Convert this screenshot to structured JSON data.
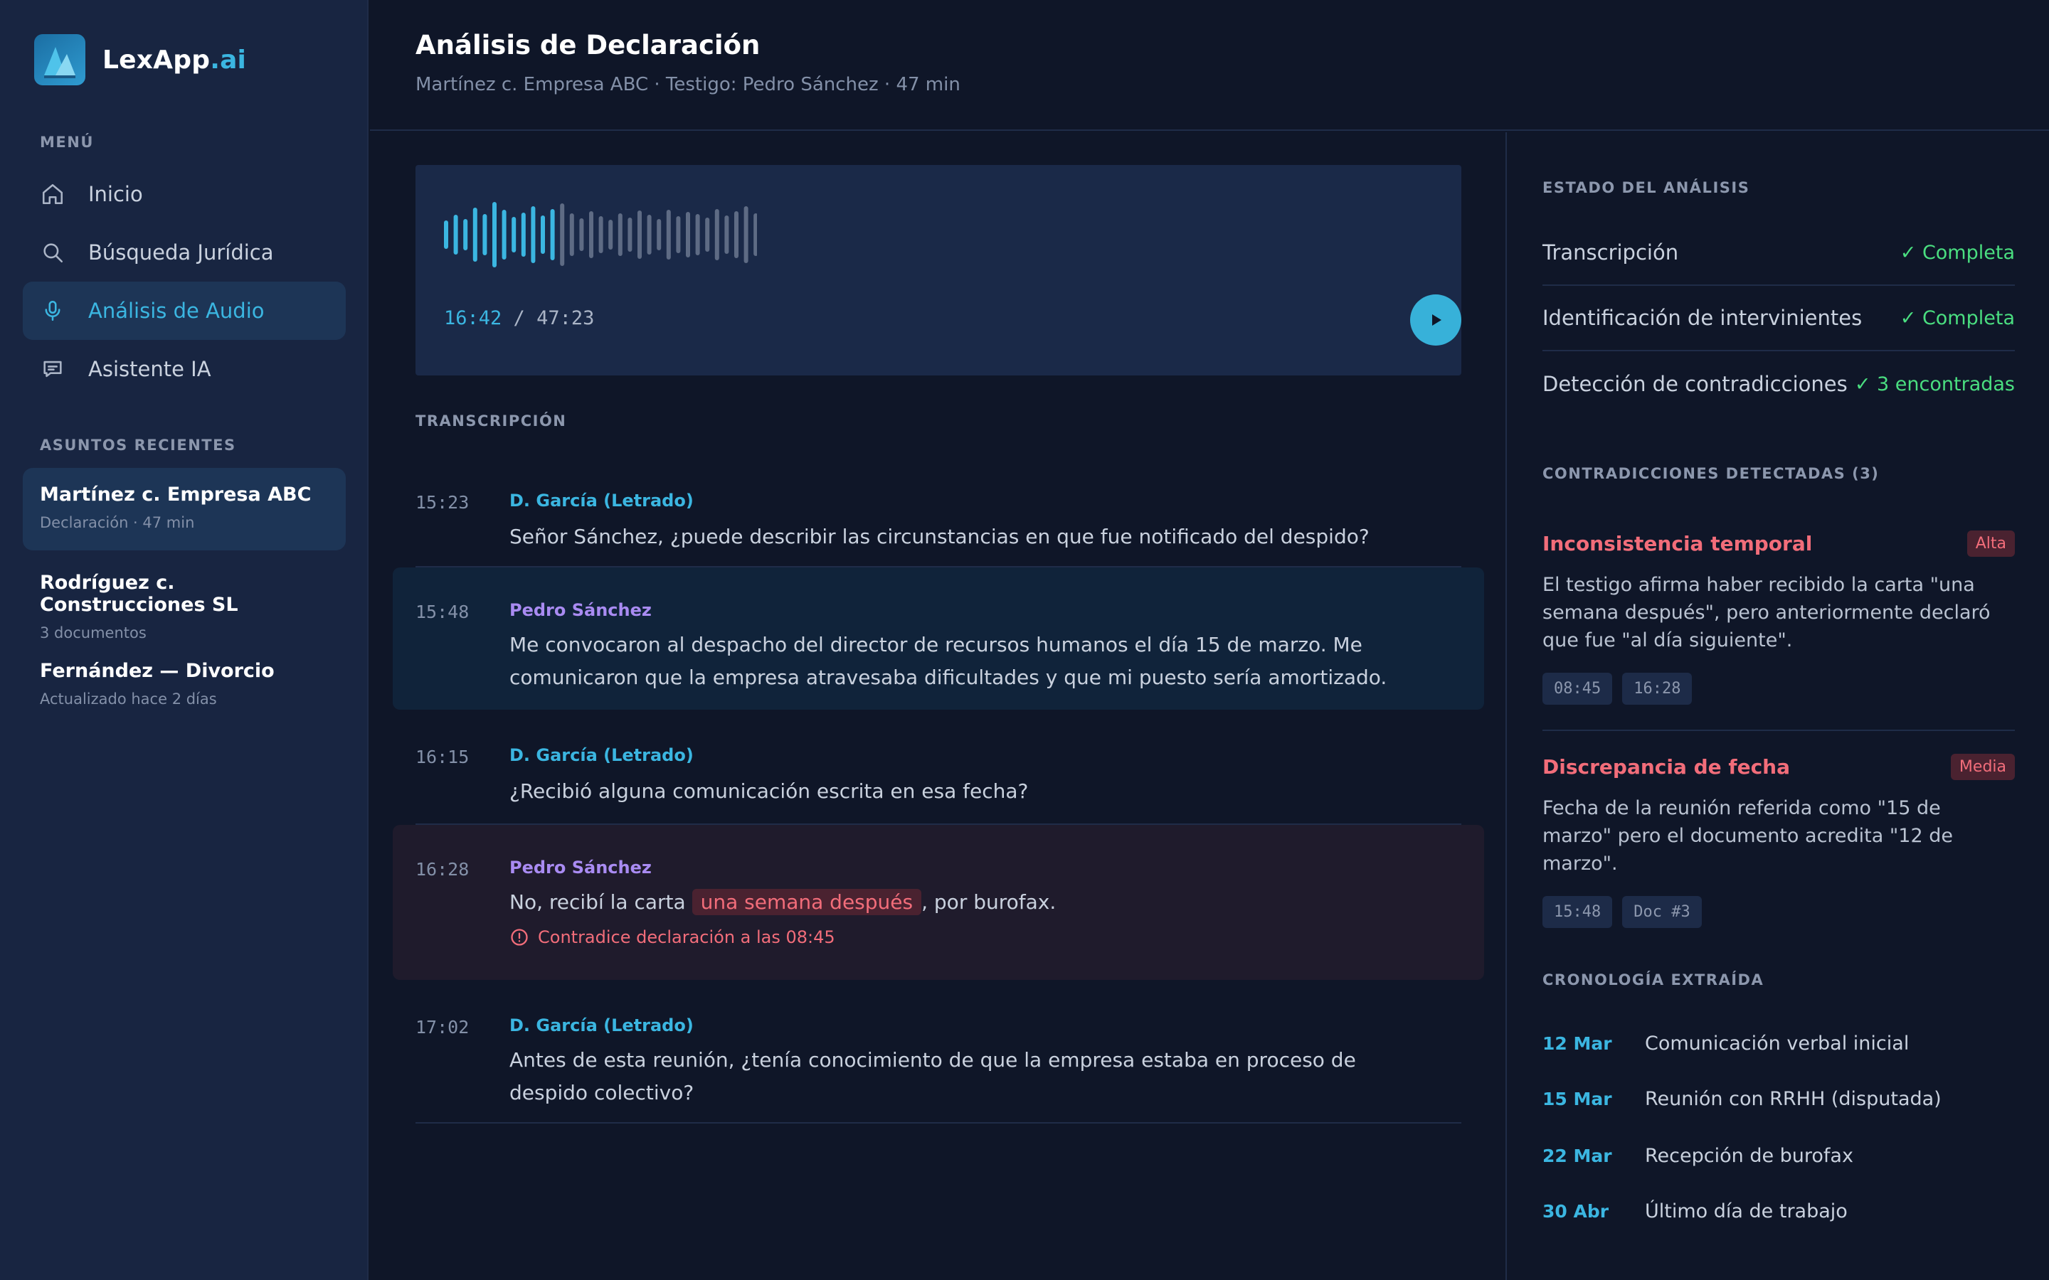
{
  "brand": {
    "name_main": "LexApp",
    "name_tld": ".ai"
  },
  "sidebar": {
    "menu_label": "MENÚ",
    "items": [
      {
        "label": "Inicio",
        "icon": "home-icon"
      },
      {
        "label": "Búsqueda Jurídica",
        "icon": "search-icon"
      },
      {
        "label": "Análisis de Audio",
        "icon": "microphone-icon",
        "active": true
      },
      {
        "label": "Asistente IA",
        "icon": "chat-icon"
      }
    ],
    "recent_label": "ASUNTOS RECIENTES",
    "cases": [
      {
        "title": "Martínez c. Empresa ABC",
        "sub": "Declaración · 47 min",
        "active": true
      },
      {
        "title": "Rodríguez c. Construcciones SL",
        "sub": "3 documentos"
      },
      {
        "title": "Fernández — Divorcio",
        "sub": "Actualizado hace 2 días"
      }
    ]
  },
  "header": {
    "title": "Análisis de Declaración",
    "subtitle": "Martínez c. Empresa ABC · Testigo: Pedro Sánchez · 47 min"
  },
  "player": {
    "current": "16:42",
    "separator": " / ",
    "total": "47:23",
    "progress": 0.353,
    "accent": "#3bb6e1"
  },
  "transcript": {
    "label": "TRANSCRIPCIÓN",
    "entries": [
      {
        "time": "15:23",
        "speaker": "D. García (Letrado)",
        "text": "Señor Sánchez, ¿puede describir las circunstancias en que fue notificado del despido?"
      },
      {
        "time": "15:48",
        "speaker": "Pedro Sánchez",
        "text": "Me convocaron al despacho del director de recursos humanos el día 15 de marzo. Me comunicaron que la empresa atravesaba dificultades y que mi puesto sería amortizado."
      },
      {
        "time": "16:15",
        "speaker": "D. García (Letrado)",
        "text": "¿Recibió alguna comunicación escrita en esa fecha?"
      },
      {
        "time": "16:28",
        "speaker": "Pedro Sánchez",
        "text_before": "No, recibí la carta ",
        "text_mark": "una semana después",
        "text_after": ", por burofax.",
        "warning": "Contradice declaración a las 08:45"
      },
      {
        "time": "17:02",
        "speaker": "D. García (Letrado)",
        "text": "Antes de esta reunión, ¿tenía conocimiento de que la empresa estaba en proceso de despido colectivo?"
      }
    ]
  },
  "analysis": {
    "label": "ESTADO DEL ANÁLISIS",
    "rows": [
      {
        "name": "Transcripción",
        "value": "✓ Completa"
      },
      {
        "name": "Identificación de intervinientes",
        "value": "✓ Completa"
      },
      {
        "name": "Detección de contradicciones",
        "value": "✓ 3 encontradas"
      }
    ]
  },
  "contradictions": {
    "label": "CONTRADICCIONES DETECTADAS (3)",
    "items": [
      {
        "title": "Inconsistencia temporal",
        "severity": "Alta",
        "desc": "El testigo afirma haber recibido la carta \"una semana después\", pero anteriormente declaró que fue \"al día siguiente\".",
        "refs": [
          "08:45",
          "16:28"
        ]
      },
      {
        "title": "Discrepancia de fecha",
        "severity": "Media",
        "desc": "Fecha de la reunión referida como \"15 de marzo\" pero el documento acredita \"12 de marzo\".",
        "refs": [
          "15:48",
          "Doc #3"
        ]
      }
    ]
  },
  "chronology": {
    "label": "CRONOLOGÍA EXTRAÍDA",
    "events": [
      {
        "date": "12 Mar",
        "event": "Comunicación verbal inicial"
      },
      {
        "date": "15 Mar",
        "event": "Reunión con RRHH (disputada)"
      },
      {
        "date": "22 Mar",
        "event": "Recepción de burofax"
      },
      {
        "date": "30 Abr",
        "event": "Último día de trabajo"
      }
    ]
  }
}
